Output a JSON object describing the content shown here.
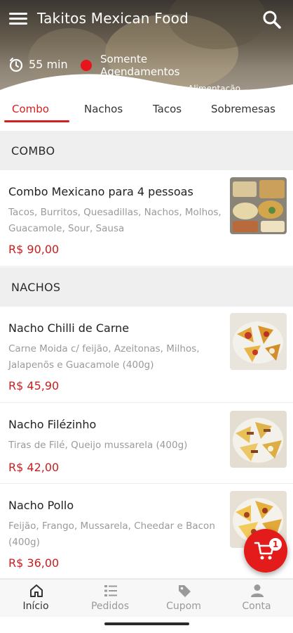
{
  "header": {
    "title": "Takitos Mexican Food",
    "menu_icon": "hamburger-menu-icon",
    "search_icon": "search-icon",
    "delivery_time": "55 min",
    "status_label": "Somente Agendamentos",
    "status_color": "#e8141b",
    "category_hint": "Alimentação"
  },
  "tabs": [
    {
      "label": "Combo",
      "active": true
    },
    {
      "label": "Nachos",
      "active": false
    },
    {
      "label": "Tacos",
      "active": false
    },
    {
      "label": "Sobremesas",
      "active": false
    }
  ],
  "sections": [
    {
      "title": "COMBO",
      "items": [
        {
          "name": "Combo Mexicano para 4 pessoas",
          "description": "Tacos, Burritos, Quesadillas, Nachos, Molhos, Guacamole, Sour, Sausa",
          "price": "R$ 90,00"
        }
      ]
    },
    {
      "title": "NACHOS",
      "items": [
        {
          "name": "Nacho Chilli de Carne",
          "description": "Carne Moida c/ feijão, Azeitonas, Milhos, Jalapenõs e Guacamole (400g)",
          "price": "R$ 45,90"
        },
        {
          "name": "Nacho Filézinho",
          "description": "Tiras de Filé, Queijo mussarela (400g)",
          "price": "R$ 42,00"
        },
        {
          "name": "Nacho Pollo",
          "description": "Feijão, Frango, Mussarela, Cheedar e Bacon (400g)",
          "price": "R$ 36,00"
        }
      ]
    }
  ],
  "cart": {
    "count": "1",
    "icon": "cart-icon",
    "color": "#e41b1b"
  },
  "bottom_nav": [
    {
      "label": "Início",
      "icon": "home-icon",
      "active": true
    },
    {
      "label": "Pedidos",
      "icon": "orders-list-icon",
      "active": false
    },
    {
      "label": "Cupom",
      "icon": "coupon-tag-icon",
      "active": false
    },
    {
      "label": "Conta",
      "icon": "account-icon",
      "active": false
    }
  ],
  "colors": {
    "accent": "#d21f1f",
    "price": "#c81e1e"
  }
}
